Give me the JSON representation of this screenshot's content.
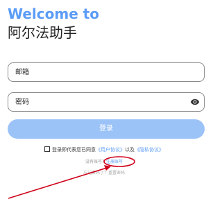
{
  "header": {
    "welcome": "Welcome to",
    "app_name": "阿尔法助手"
  },
  "form": {
    "email_placeholder": "邮箱",
    "password_placeholder": "密码",
    "login_label": "登录"
  },
  "agreement": {
    "prefix": "登录即代表您已同意",
    "user_agreement": "《用户协议》",
    "and": "以及",
    "privacy_policy": "《隐私协议》"
  },
  "register": {
    "prompt": "没有账号？",
    "link": "注册账号"
  },
  "forgot": {
    "prompt": "忘记密码了？",
    "link": "重置密码"
  },
  "icons": {
    "password_toggle": "eye-icon"
  },
  "colors": {
    "accent": "#5b9cf6",
    "button": "#9cc3f7",
    "annotation": "#d0021b"
  }
}
